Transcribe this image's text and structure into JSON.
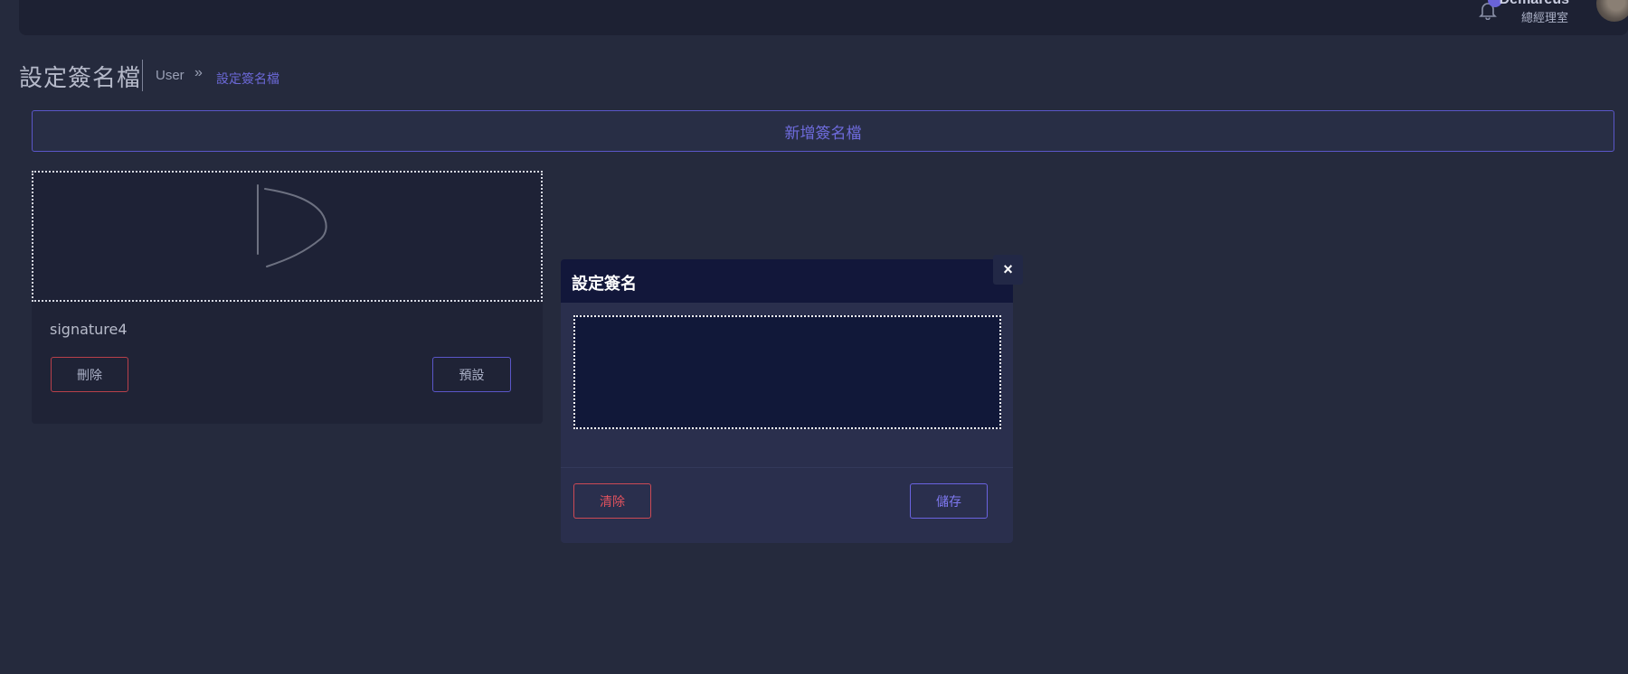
{
  "topbar": {
    "user_name": "Demareus",
    "user_role": "總經理室",
    "icons": {
      "bell": "bell-icon",
      "avatar": "avatar"
    },
    "badge_color": "#6a63d8"
  },
  "header": {
    "title": "設定簽名檔",
    "breadcrumb": {
      "root": "User",
      "separator": "»",
      "current": "設定簽名檔"
    }
  },
  "main": {
    "add_button_label": "新增簽名檔",
    "signatures": [
      {
        "name": "signature4",
        "delete_label": "刪除",
        "default_label": "預設"
      }
    ]
  },
  "modal": {
    "title": "設定簽名",
    "close_label": "×",
    "clear_label": "清除",
    "save_label": "儲存"
  },
  "colors": {
    "accent": "#5a56c8",
    "danger": "#cc4a55",
    "background": "#252a3d",
    "modal_header": "#12173a"
  }
}
